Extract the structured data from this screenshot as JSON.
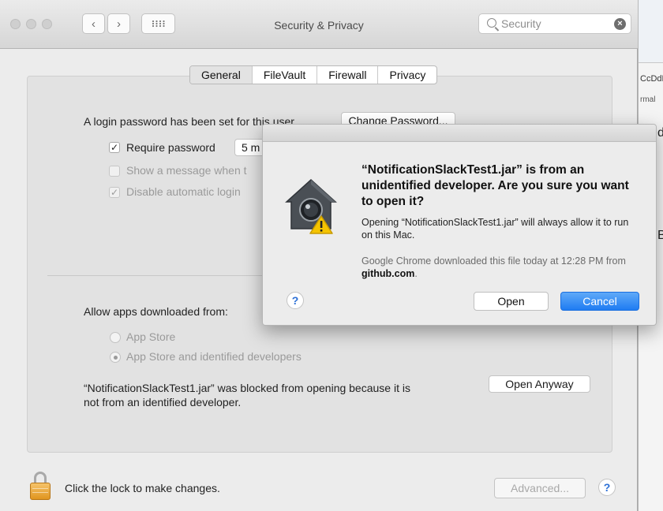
{
  "window": {
    "title": "Security & Privacy",
    "search_placeholder": "Security"
  },
  "tabs": [
    {
      "label": "General",
      "active": true
    },
    {
      "label": "FileVault",
      "active": false
    },
    {
      "label": "Firewall",
      "active": false
    },
    {
      "label": "Privacy",
      "active": false
    }
  ],
  "general": {
    "login_text": "A login password has been set for this user",
    "change_password_label": "Change Password...",
    "require_password_label": "Require password",
    "require_password_value": "5 m",
    "show_message_label": "Show a message when t",
    "disable_auto_login_label": "Disable automatic login",
    "allow_apps_label": "Allow apps downloaded from:",
    "app_store_label": "App Store",
    "app_store_identified_label": "App Store and identified developers",
    "blocked_text_line1": "“NotificationSlackTest1.jar” was blocked from opening because it is",
    "blocked_text_line2": "not from an identified developer.",
    "open_anyway_label": "Open Anyway"
  },
  "footer": {
    "lock_text": "Click the lock to make changes.",
    "advanced_label": "Advanced...",
    "help_label": "?"
  },
  "dialog": {
    "title": "“NotificationSlackTest1.jar” is from an unidentified developer. Are you sure you want to open it?",
    "message": "Opening “NotificationSlackTest1.jar” will always allow it to run on this Mac.",
    "note_prefix": "Google Chrome downloaded this file today at 12:28 PM from ",
    "note_source": "github.com",
    "note_suffix": ".",
    "help_label": "?",
    "open_label": "Open",
    "cancel_label": "Cancel"
  },
  "background_app": {
    "text1": "CcDdE",
    "text2": "rmal",
    "text3": "d",
    "text4": "B"
  },
  "colors": {
    "accent": "#1f7cf2",
    "lock": "#e0951f",
    "warning": "#f5c400"
  }
}
